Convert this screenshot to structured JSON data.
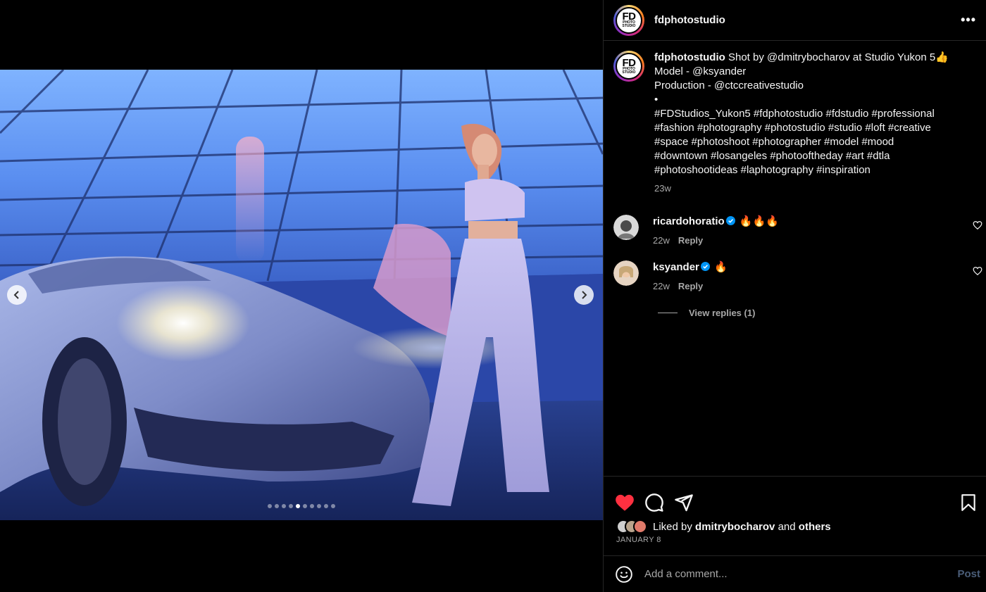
{
  "post": {
    "username": "fdphotostudio",
    "logo_text": "FD",
    "logo_sub": "PHOTO STUDIO",
    "more_label": "•••",
    "carousel": {
      "count": 10,
      "active_index": 4
    }
  },
  "caption": {
    "username": "fdphotostudio",
    "lines": [
      "Shot by @dmitrybocharov at Studio Yukon 5👍",
      "Model - @ksyander",
      "Production - @ctccreativestudio",
      "•",
      "#FDStudios_Yukon5 #fdphotostudio #fdstudio #professional",
      "#fashion #photography #photostudio #studio #loft #creative",
      "#space #photoshoot #photographer #model #mood",
      "#downtown #losangeles #photooftheday #art #dtla",
      "#photoshootideas #laphotography #inspiration"
    ],
    "time": "23w"
  },
  "comments": [
    {
      "username": "ricardohoratio",
      "text": "🔥🔥🔥",
      "time": "22w",
      "reply": "Reply"
    },
    {
      "username": "ksyander",
      "text": "🔥",
      "time": "22w",
      "reply": "Reply"
    }
  ],
  "view_replies": "View replies (1)",
  "likes": {
    "prefix": "Liked by",
    "user": "dmitrybocharov",
    "middle": "and",
    "others": "others"
  },
  "date": "JANUARY 8",
  "add_comment": {
    "placeholder": "Add a comment...",
    "post": "Post"
  },
  "colors": {
    "heart_liked": "#ff3040",
    "verified": "#0095f6",
    "post_disabled": "#4a5d78"
  }
}
